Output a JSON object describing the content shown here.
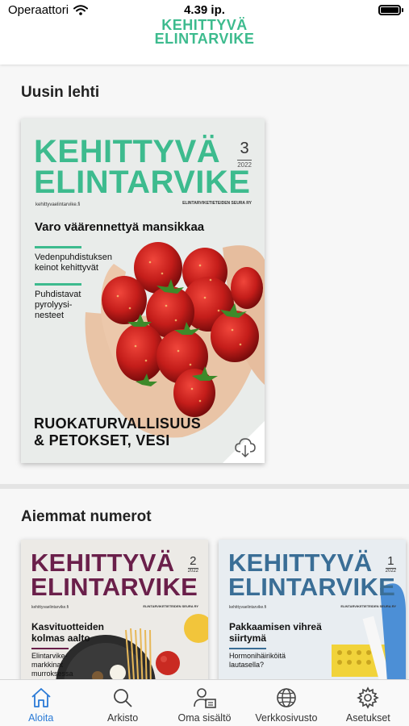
{
  "status_bar": {
    "carrier": "Operaattori",
    "time": "4.39 ip."
  },
  "header": {
    "logo_line1": "KEHITTYVÄ",
    "logo_line2": "ELINTARVIKE"
  },
  "latest": {
    "section_title": "Uusin lehti",
    "cover": {
      "title_line1": "KEHITTYVÄ",
      "title_line2": "ELINTARVIKE",
      "issue_number": "3",
      "issue_year": "2022",
      "url": "kehittyvaelintarvike.fi",
      "publisher": "ELINTARVIKETIETEIDEN SEURA RY",
      "headline": "Varo väärennettyä mansikkaa",
      "teaser1": "Vedenpuhdistuksen keinot kehittyvät",
      "teaser2": "Puhdistavat pyrolyysi-nesteet",
      "footer_line1": "RUOKATURVALLISUUS",
      "footer_line2": "& PETOKSET, VESI",
      "download_icon": "cloud-download-icon"
    }
  },
  "previous": {
    "section_title": "Aiemmat numerot",
    "issues": [
      {
        "title_line1": "KEHITTYVÄ",
        "title_line2": "ELINTARVIKE",
        "issue_number": "2",
        "issue_year": "2022",
        "url": "kehittyvaelintarvike.fi",
        "publisher": "ELINTARVIKETIETEIDEN SEURA RY",
        "headline": "Kasvituotteiden kolmas aalto",
        "teaser": "Elintarvike-markkinat murroksessa",
        "color": "#6a1f4a"
      },
      {
        "title_line1": "KEHITTYVÄ",
        "title_line2": "ELINTARVIKE",
        "issue_number": "1",
        "issue_year": "2022",
        "url": "kehittyvaelintarvike.fi",
        "publisher": "ELINTARVIKETIETEIDEN SEURA RY",
        "headline": "Pakkaamisen vihreä siirtymä",
        "teaser": "Hormonihäiriköitä lautasella?",
        "color": "#3a6e96"
      }
    ]
  },
  "tabs": [
    {
      "label": "Aloita",
      "icon": "home-icon",
      "active": true
    },
    {
      "label": "Arkisto",
      "icon": "search-icon",
      "active": false
    },
    {
      "label": "Oma sisältö",
      "icon": "user-content-icon",
      "active": false
    },
    {
      "label": "Verkkosivusto",
      "icon": "globe-icon",
      "active": false
    },
    {
      "label": "Asetukset",
      "icon": "gear-icon",
      "active": false
    }
  ],
  "colors": {
    "brand_green": "#3dbb8e",
    "active_tab": "#2a7ad6"
  }
}
